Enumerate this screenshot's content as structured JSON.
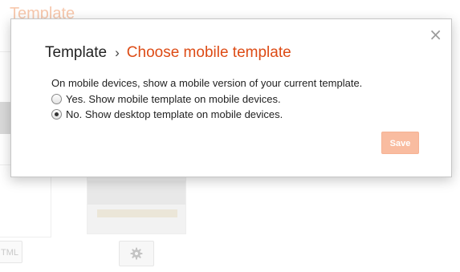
{
  "background": {
    "page_title": "Template",
    "html_button_label": "TML",
    "gear_icon": "gear-icon"
  },
  "dialog": {
    "breadcrumb_root": "Template",
    "breadcrumb_separator": "›",
    "breadcrumb_current": "Choose mobile template",
    "intro": "On mobile devices, show a mobile version of your current template.",
    "options": [
      {
        "label": "Yes. Show mobile template on mobile devices.",
        "checked": false
      },
      {
        "label": "No. Show desktop template on mobile devices.",
        "checked": true
      }
    ],
    "save_label": "Save",
    "close_glyph": "×",
    "save_state": "disabled"
  },
  "colors": {
    "accent": "#dd4b15",
    "save_disabled": "#f9bca0"
  }
}
